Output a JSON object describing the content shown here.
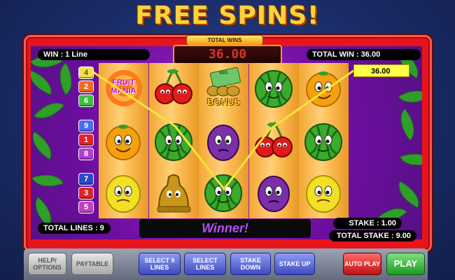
{
  "title": "FREE SPINS!",
  "total_wins": {
    "label": "TOTAL WINS",
    "value": "36.00"
  },
  "win_lines": "WIN : 1 Line",
  "total_win": "TOTAL WIN : 36.00",
  "line_win_value": "36.00",
  "total_lines": "TOTAL LINES : 9",
  "stake": "STAKE : 1.00",
  "total_stake": "TOTAL STAKE : 9.00",
  "winner_text": "Winner!",
  "left_badges": [
    "4",
    "2",
    "6",
    "9",
    "1",
    "8",
    "7",
    "3",
    "5"
  ],
  "badge_colors": [
    "#f0e050",
    "#f06a1a",
    "#3fbf3f",
    "#4a6cf0",
    "#e0242a",
    "#b040d0",
    "#2a48c8",
    "#e0242a",
    "#c040c0"
  ],
  "symbols": {
    "fruit_mania_text": "FRUIT MANIA",
    "bonus_text": "BONUS",
    "big_text": "BIG"
  },
  "buttons": {
    "help": "HELP/ OPTIONS",
    "paytable": "PAYTABLE",
    "select_9": "SELECT 9 LINES",
    "select_lines": "SELECT LINES",
    "stake_down": "STAKE DOWN",
    "stake_up": "STAKE UP",
    "autoplay": "AUTO PLAY",
    "play": "PLAY"
  }
}
